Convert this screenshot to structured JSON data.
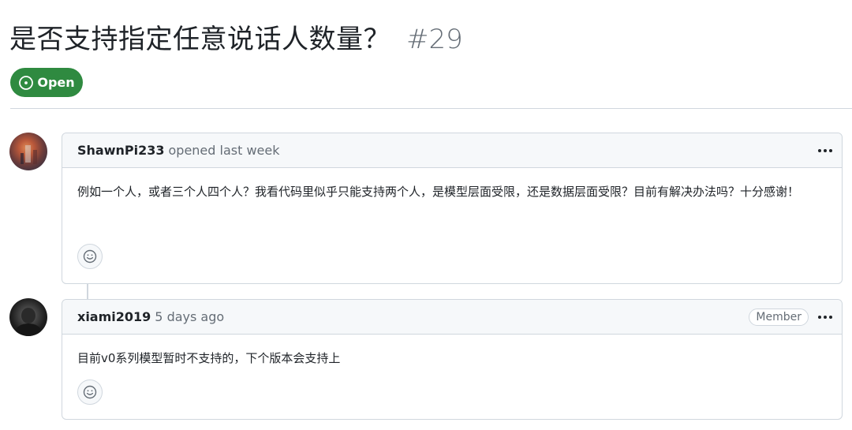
{
  "issue": {
    "title": "是否支持指定任意说话人数量？",
    "number": "#29",
    "state": "Open",
    "state_icon": "issue-opened-icon",
    "state_color": "#2f8a40"
  },
  "comments": [
    {
      "author": "ShawnPi233",
      "meta": "opened last week",
      "badge": "",
      "body": "例如一个人，或者三个人四个人？我看代码里似乎只能支持两个人，是模型层面受限，还是数据层面受限？目前有解决办法吗？十分感谢！",
      "reaction_icon": "smiley-icon",
      "menu_icon": "kebab-horizontal-icon"
    },
    {
      "author": "xiami2019",
      "meta": "5 days ago",
      "badge": "Member",
      "body": "目前v0系列模型暂时不支持的，下个版本会支持上",
      "reaction_icon": "smiley-icon",
      "menu_icon": "kebab-horizontal-icon"
    }
  ]
}
